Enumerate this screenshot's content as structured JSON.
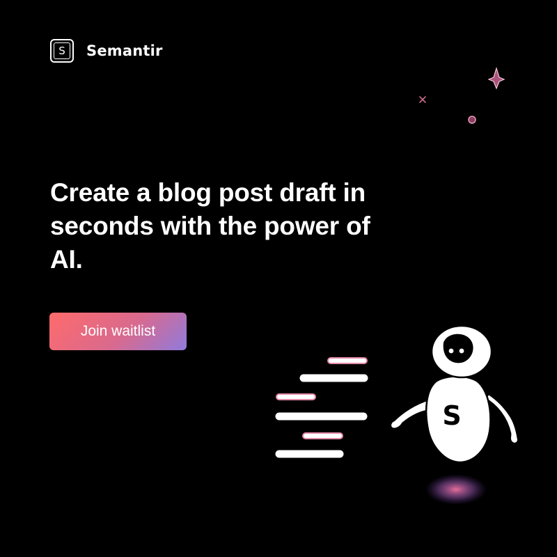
{
  "brand": {
    "logo_letter": "S",
    "name": "Semantir"
  },
  "hero": {
    "headline": "Create a blog post draft in seconds with the power of AI."
  },
  "cta": {
    "label": "Join waitlist"
  },
  "mascot": {
    "chest_letter": "S"
  },
  "colors": {
    "background": "#000000",
    "text": "#ffffff",
    "accent_pink": "#ff7aa8",
    "accent_purple": "#8f7bdc",
    "accent_coral": "#ff6b6b"
  },
  "icons": [
    "logo-mark",
    "sparkle-icon",
    "cross-icon",
    "dot-icon",
    "robot-mascot"
  ]
}
